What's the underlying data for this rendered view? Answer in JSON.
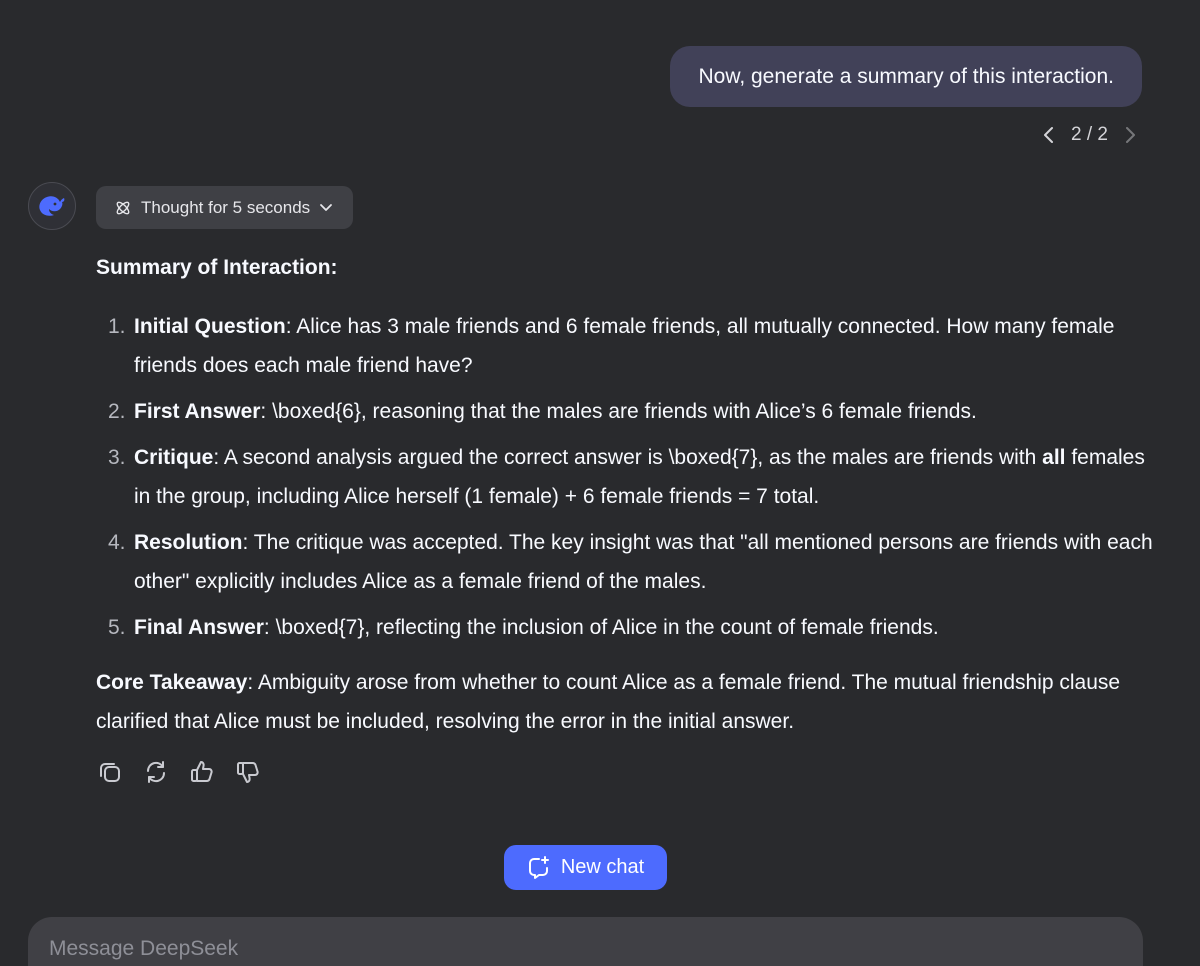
{
  "user_message": {
    "text": "Now, generate a summary of this interaction.",
    "pager": "2 / 2"
  },
  "assistant": {
    "thought_label": "Thought for 5 seconds",
    "heading": "Summary of Interaction:",
    "items": [
      {
        "num": "1.",
        "title": "Initial Question",
        "text": ": Alice has 3 male friends and 6 female friends, all mutually connected. How many female friends does each male friend have?"
      },
      {
        "num": "2.",
        "title": "First Answer",
        "text": ": \\boxed{6}, reasoning that the males are friends with Alice’s 6 female friends."
      },
      {
        "num": "3.",
        "title": "Critique",
        "text_a": ": A second analysis argued the correct answer is \\boxed{7}, as the males are friends with ",
        "bold": "all",
        "text_b": " females in the group, including Alice herself (1 female) + 6 female friends = 7 total."
      },
      {
        "num": "4.",
        "title": "Resolution",
        "text": ": The critique was accepted. The key insight was that \"all mentioned persons are friends with each other\" explicitly includes Alice as a female friend of the males."
      },
      {
        "num": "5.",
        "title": "Final Answer",
        "text": ": \\boxed{7}, reflecting the inclusion of Alice in the count of female friends."
      }
    ],
    "takeaway_title": "Core Takeaway",
    "takeaway_text": ": Ambiguity arose from whether to count Alice as a female friend. The mutual friendship clause clarified that Alice must be included, resolving the error in the initial answer.",
    "actions": [
      "copy-icon",
      "regenerate-icon",
      "thumbs-up-icon",
      "thumbs-down-icon"
    ]
  },
  "new_chat_label": "New chat",
  "composer": {
    "placeholder": "Message DeepSeek"
  },
  "colors": {
    "background": "#292a2d",
    "user_bubble": "#414158",
    "accent": "#4d6bfe"
  }
}
